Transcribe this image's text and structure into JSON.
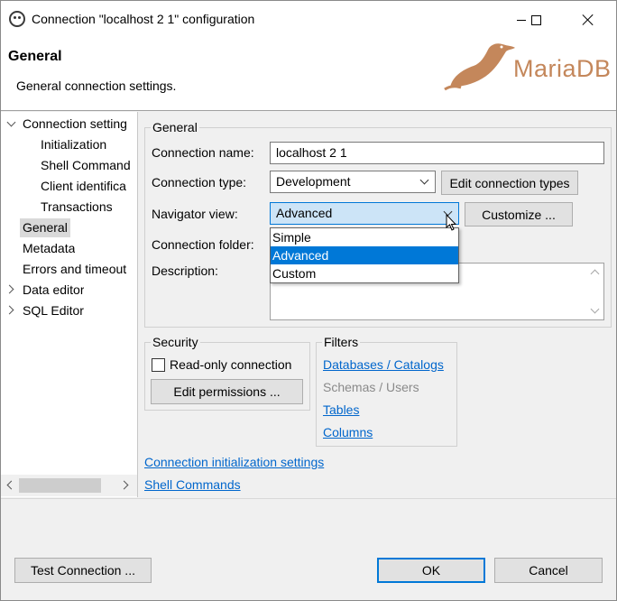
{
  "window": {
    "title": "Connection \"localhost 2 1\" configuration"
  },
  "header": {
    "title": "General",
    "description": "General connection settings.",
    "logo_text": "MariaDB"
  },
  "nav": {
    "items": [
      {
        "label": "Connection setting",
        "expander": "expanded"
      },
      {
        "label": "Initialization"
      },
      {
        "label": "Shell Command"
      },
      {
        "label": "Client identifica"
      },
      {
        "label": "Transactions"
      },
      {
        "label": "General",
        "selected": true
      },
      {
        "label": "Metadata"
      },
      {
        "label": "Errors and timeout"
      },
      {
        "label": "Data editor",
        "expander": "collapsed"
      },
      {
        "label": "SQL Editor",
        "expander": "collapsed"
      }
    ]
  },
  "general": {
    "group_title": "General",
    "connection_name_label": "Connection name:",
    "connection_name_value": "localhost 2 1",
    "connection_type_label": "Connection type:",
    "connection_type_value": "Development",
    "edit_connection_types": "Edit connection types",
    "navigator_view_label": "Navigator view:",
    "navigator_view_value": "Advanced",
    "customize": "Customize ...",
    "navigator_options": [
      "Simple",
      "Advanced",
      "Custom"
    ],
    "connection_folder_label": "Connection folder:",
    "description_label": "Description:"
  },
  "security": {
    "title": "Security",
    "read_only_label": "Read-only connection",
    "edit_permissions": "Edit permissions ..."
  },
  "filters": {
    "title": "Filters",
    "links": [
      "Databases / Catalogs",
      "Schemas / Users",
      "Tables",
      "Columns"
    ]
  },
  "links": {
    "init_settings": "Connection initialization settings",
    "shell_commands": "Shell Commands"
  },
  "footer": {
    "test_connection": "Test Connection ...",
    "ok": "OK",
    "cancel": "Cancel"
  },
  "colors": {
    "accent": "#0078d7",
    "link": "#0066cc",
    "logo": "#c4875b"
  }
}
